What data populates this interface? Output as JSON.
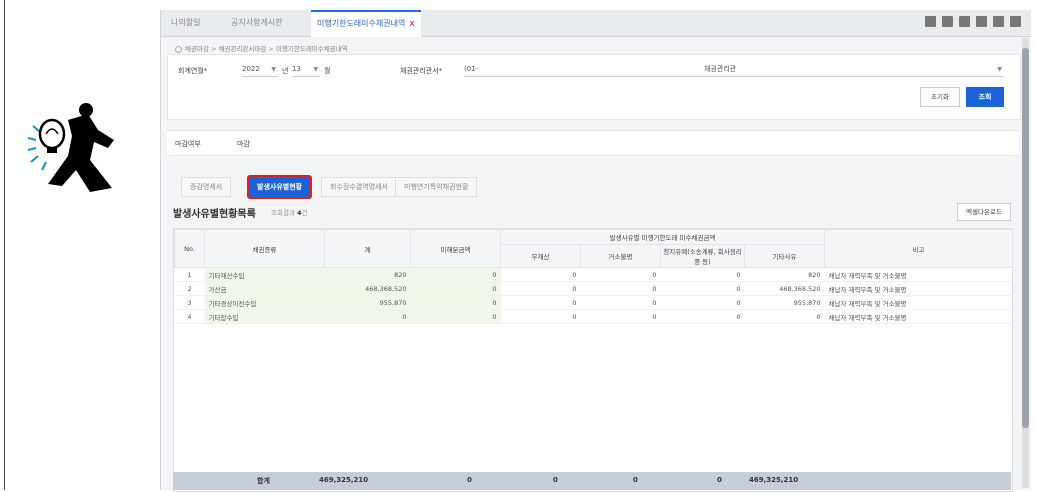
{
  "tabs": [
    {
      "label": "나의할일",
      "active": false
    },
    {
      "label": "공지사항게시판",
      "active": false
    },
    {
      "label": "미행기한도래미수채권내역",
      "active": true
    }
  ],
  "tab_close": "x",
  "breadcrumb": "채권마감 > 채권관리관서마감 > 미행기한도래미수채권내역",
  "search": {
    "year_label": "회계연월*",
    "year_value": "2022",
    "year_unit": "년",
    "month_value": "13",
    "month_unit": "월",
    "office_label": "채권관리관서*",
    "office_code": "(01-",
    "office_name": "채권관리관",
    "reset_label": "초기화",
    "search_label": "조회"
  },
  "close_status": {
    "label": "마감여부",
    "value": "마감"
  },
  "subtabs": [
    {
      "label": "증감명세서",
      "active": false
    },
    {
      "label": "발생사유별현황",
      "active": true
    },
    {
      "label": "회수징수결역명세서",
      "active": false
    },
    {
      "label": "미행연기특약채권현황",
      "active": false
    }
  ],
  "list": {
    "title": "발생사유별현황목록",
    "count_label": "조회결과",
    "count": "4",
    "count_unit": "건",
    "excel_label": "엑셀다운로드"
  },
  "table": {
    "headers": {
      "no": "No.",
      "type": "채권종류",
      "total": "계",
      "collected": "미해분금액",
      "group": "발생사유별 미행기한도래 미수채권금액",
      "sub": [
        "무재산",
        "거소불명",
        "청지유예(소송계류, 회사정리중 등)",
        "기타사유"
      ],
      "note": "비고"
    },
    "rows": [
      {
        "no": "1",
        "type": "기타재산수입",
        "total": "820",
        "collected": "0",
        "s1": "0",
        "s2": "0",
        "s3": "0",
        "s4": "820",
        "note": "채납자 재력부족 및 거소불명"
      },
      {
        "no": "2",
        "type": "가산금",
        "total": "468,368,520",
        "collected": "0",
        "s1": "0",
        "s2": "0",
        "s3": "0",
        "s4": "468,368,520",
        "note": "채납자 재력부족 및 거소불명"
      },
      {
        "no": "3",
        "type": "기타경상이전수입",
        "total": "955,870",
        "collected": "0",
        "s1": "0",
        "s2": "0",
        "s3": "0",
        "s4": "955,870",
        "note": "채납자 재력부족 및 거소불명"
      },
      {
        "no": "4",
        "type": "기타잡수입",
        "total": "0",
        "collected": "0",
        "s1": "0",
        "s2": "0",
        "s3": "0",
        "s4": "0",
        "note": "채납자 재력부족 및 거소불명"
      }
    ],
    "footer": {
      "label": "합계",
      "total": "469,325,210",
      "collected": "0",
      "s1": "0",
      "s2": "0",
      "s3": "0",
      "s4": "469,325,210"
    }
  },
  "colors": {
    "accent": "#1a63d8",
    "highlight_border": "#e02020",
    "row_green": "#eef7e8"
  }
}
